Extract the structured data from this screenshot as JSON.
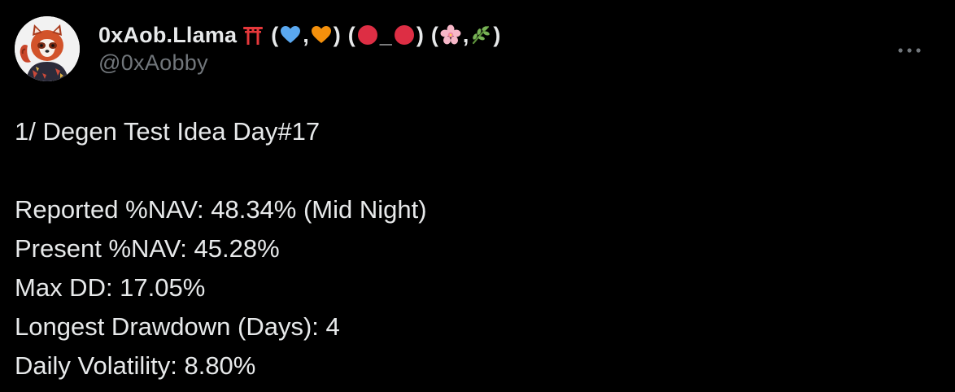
{
  "author": {
    "display_name": "0xAob.Llama",
    "handle": "@0xAobby",
    "name_decorations": {
      "paren_open": "(",
      "paren_close": ")",
      "comma": ",",
      "underscore": "_"
    },
    "icons": [
      "torii-gate-icon",
      "blue-heart-icon",
      "orange-heart-icon",
      "red-circle-icon",
      "cherry-blossom-icon",
      "herb-icon"
    ]
  },
  "tweet": {
    "lines": [
      "1/ Degen Test Idea Day#17",
      "",
      "Reported %NAV: 48.34% (Mid Night)",
      "Present %NAV: 45.28%",
      "Max DD: 17.05%",
      "Longest Drawdown (Days): 4",
      "Daily Volatility: 8.80%"
    ]
  },
  "colors": {
    "background": "#000000",
    "text_primary": "#e7e9ea",
    "text_secondary": "#71767b",
    "torii_red": "#e5383b",
    "blue_heart": "#5aa8f0",
    "orange_heart": "#f4900c",
    "red_circle": "#dd2e44",
    "blossom_pink": "#f7b7c8",
    "herb_green": "#77b255"
  }
}
